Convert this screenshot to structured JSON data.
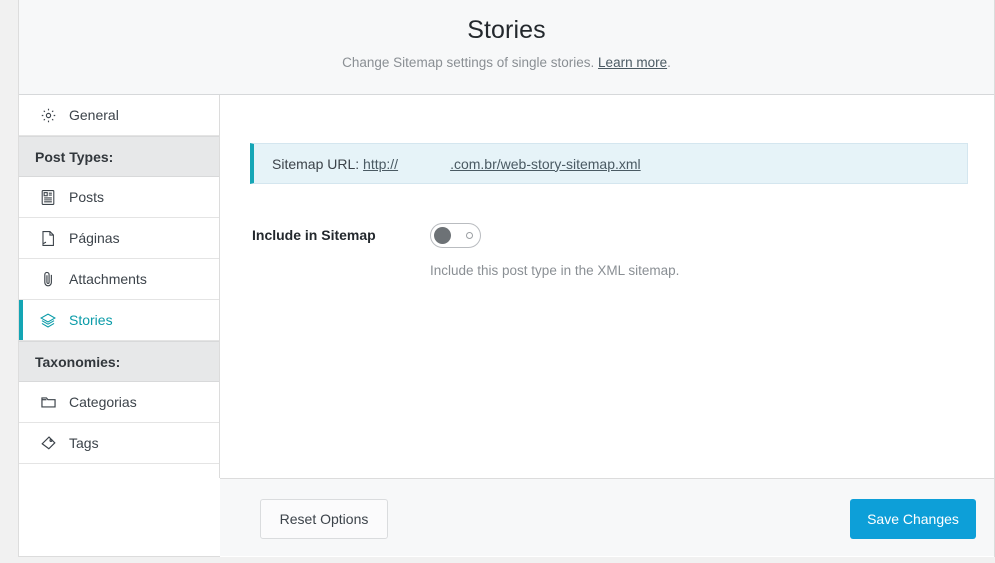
{
  "header": {
    "title": "Stories",
    "subtitle_text": "Change Sitemap settings of single stories.",
    "learn_more_label": "Learn more",
    "subtitle_suffix": "."
  },
  "sidebar": {
    "items": [
      {
        "type": "item",
        "label": "General",
        "icon": "gear-icon",
        "active": false
      },
      {
        "type": "section",
        "label": "Post Types:"
      },
      {
        "type": "item",
        "label": "Posts",
        "icon": "document-icon",
        "active": false
      },
      {
        "type": "item",
        "label": "Páginas",
        "icon": "page-icon",
        "active": false
      },
      {
        "type": "item",
        "label": "Attachments",
        "icon": "paperclip-icon",
        "active": false
      },
      {
        "type": "item",
        "label": "Stories",
        "icon": "layers-icon",
        "active": true
      },
      {
        "type": "section",
        "label": "Taxonomies:"
      },
      {
        "type": "item",
        "label": "Categorias",
        "icon": "folder-icon",
        "active": false
      },
      {
        "type": "item",
        "label": "Tags",
        "icon": "tag-icon",
        "active": false
      }
    ]
  },
  "notice": {
    "prefix": "Sitemap URL:",
    "url_scheme": "http://",
    "url_suffix": ".com.br/web-story-sitemap.xml"
  },
  "field": {
    "label": "Include in Sitemap",
    "toggle_state": "off",
    "help": "Include this post type in the XML sitemap."
  },
  "footer": {
    "reset_label": "Reset Options",
    "save_label": "Save Changes"
  },
  "colors": {
    "accent_teal": "#13a5b4",
    "save_blue": "#0d9fd8",
    "notice_bg": "#e6f3f8"
  }
}
